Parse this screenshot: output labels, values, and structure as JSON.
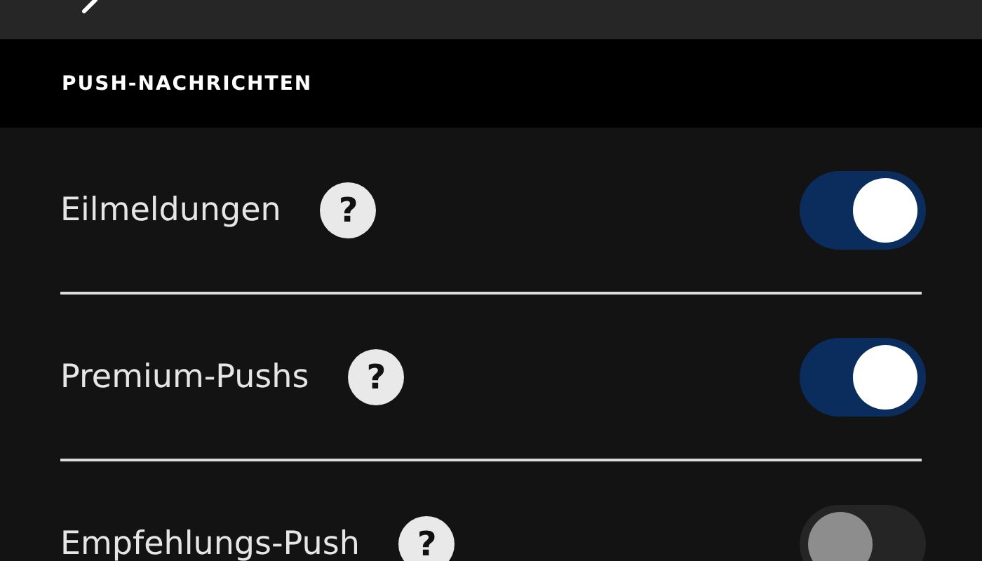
{
  "section": {
    "title": "PUSH-NACHRICHTEN"
  },
  "settings": [
    {
      "label": "Eilmeldungen",
      "help": "?",
      "on": true
    },
    {
      "label": "Premium-Pushs",
      "help": "?",
      "on": true
    },
    {
      "label": "Empfehlungs-Push",
      "help": "?",
      "on": false
    }
  ]
}
